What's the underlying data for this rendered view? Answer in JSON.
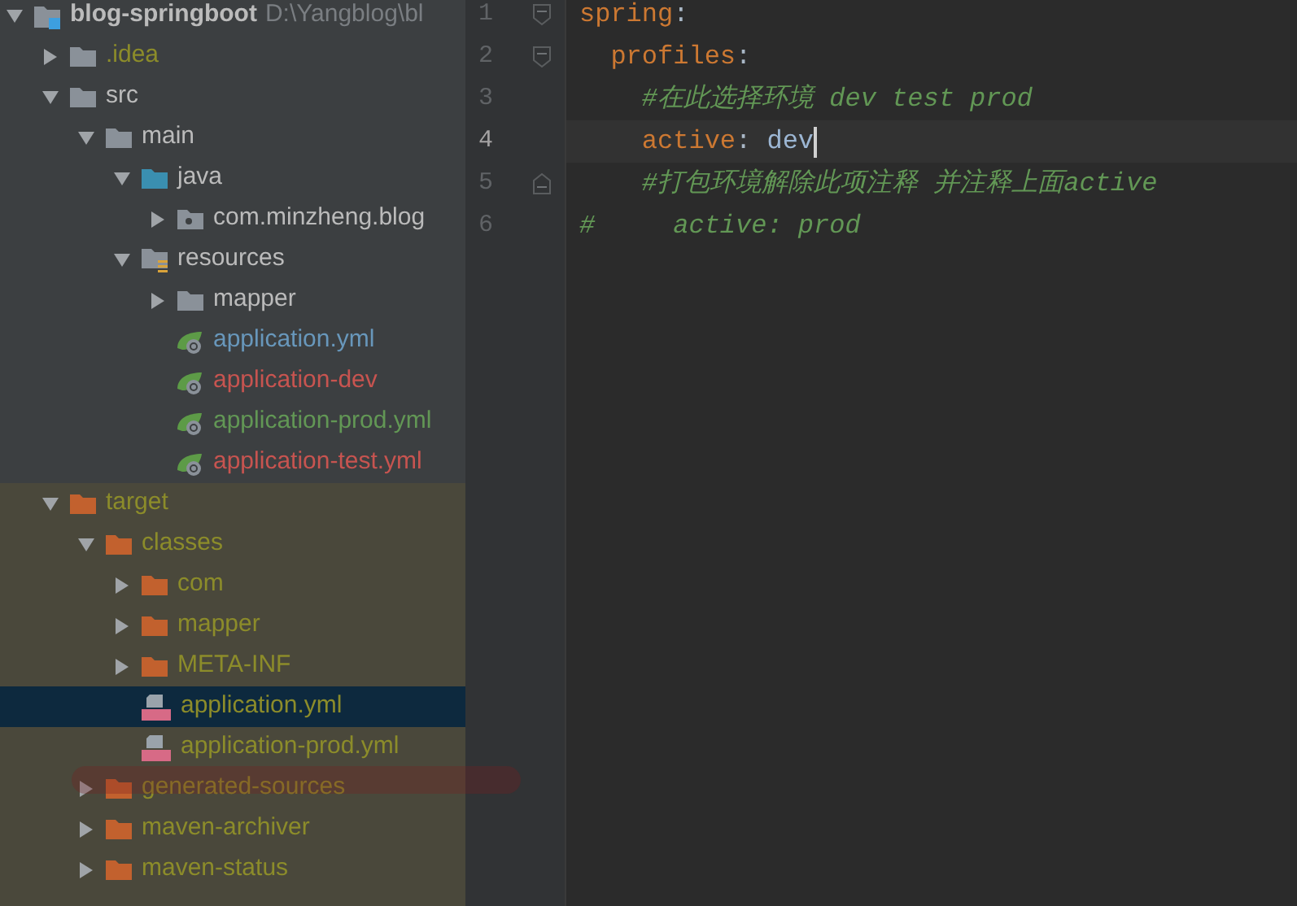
{
  "project_tree": [
    {
      "label": "blog-springboot",
      "path": "D:\\Yangblog\\bl",
      "kind": "module",
      "color": "#bbbbbb",
      "expanded": true,
      "selected": false,
      "excluded": false,
      "children": [
        {
          "label": ".idea",
          "kind": "folder",
          "color": "#8c8c2a",
          "expanded": false,
          "selected": false,
          "excluded": false
        },
        {
          "label": "src",
          "kind": "folder",
          "color": "#bbbbbb",
          "expanded": true,
          "selected": false,
          "excluded": false,
          "children": [
            {
              "label": "main",
              "kind": "folder",
              "color": "#bbbbbb",
              "expanded": true,
              "selected": false,
              "excluded": false,
              "children": [
                {
                  "label": "java",
                  "kind": "source",
                  "color": "#bbbbbb",
                  "expanded": true,
                  "selected": false,
                  "excluded": false,
                  "children": [
                    {
                      "label": "com.minzheng.blog",
                      "kind": "package",
                      "color": "#bbbbbb",
                      "expanded": false,
                      "selected": false,
                      "excluded": false
                    }
                  ]
                },
                {
                  "label": "resources",
                  "kind": "resources",
                  "color": "#bbbbbb",
                  "expanded": true,
                  "selected": false,
                  "excluded": false,
                  "children": [
                    {
                      "label": "mapper",
                      "kind": "folder",
                      "color": "#bbbbbb",
                      "expanded": false,
                      "selected": false,
                      "excluded": false
                    },
                    {
                      "label": "application.yml",
                      "kind": "spring",
                      "color": "#6897bb",
                      "selected": false,
                      "excluded": false
                    },
                    {
                      "label": "application-dev",
                      "kind": "spring",
                      "color": "#c75450",
                      "selected": false,
                      "excluded": false
                    },
                    {
                      "label": "application-prod.yml",
                      "kind": "spring",
                      "color": "#629755",
                      "selected": false,
                      "excluded": false
                    },
                    {
                      "label": "application-test.yml",
                      "kind": "spring",
                      "color": "#c75450",
                      "selected": false,
                      "excluded": false
                    }
                  ]
                }
              ]
            }
          ]
        },
        {
          "label": "target",
          "kind": "target",
          "color": "#8c8c2a",
          "expanded": true,
          "selected": false,
          "excluded": true,
          "children": [
            {
              "label": "classes",
              "kind": "target",
              "color": "#8c8c2a",
              "expanded": true,
              "selected": false,
              "excluded": true,
              "children": [
                {
                  "label": "com",
                  "kind": "target",
                  "color": "#8c8c2a",
                  "expanded": false,
                  "selected": false,
                  "excluded": true
                },
                {
                  "label": "mapper",
                  "kind": "target",
                  "color": "#8c8c2a",
                  "expanded": false,
                  "selected": false,
                  "excluded": true
                },
                {
                  "label": "META-INF",
                  "kind": "target",
                  "color": "#8c8c2a",
                  "expanded": false,
                  "selected": false,
                  "excluded": true
                },
                {
                  "label": "application.yml",
                  "kind": "yml",
                  "color": "#8c8c2a",
                  "selected": true,
                  "excluded": true
                },
                {
                  "label": "application-prod.yml",
                  "kind": "yml",
                  "color": "#8c8c2a",
                  "selected": false,
                  "excluded": true
                }
              ]
            },
            {
              "label": "generated-sources",
              "kind": "target",
              "color": "#8c8c2a",
              "expanded": false,
              "selected": false,
              "excluded": true
            },
            {
              "label": "maven-archiver",
              "kind": "target",
              "color": "#8c8c2a",
              "expanded": false,
              "selected": false,
              "excluded": true
            },
            {
              "label": "maven-status",
              "kind": "target",
              "color": "#8c8c2a",
              "expanded": false,
              "selected": false,
              "excluded": true
            }
          ]
        }
      ]
    }
  ],
  "editor": {
    "lines": [
      {
        "number": "1",
        "fold_start": true,
        "fold_end": false,
        "current": false,
        "caret": false,
        "tokens": [
          {
            "kind": "key",
            "text": "spring"
          },
          {
            "kind": "punct",
            "text": ":"
          }
        ]
      },
      {
        "number": "2",
        "fold_start": true,
        "fold_end": false,
        "current": false,
        "caret": false,
        "tokens": [
          {
            "kind": "key",
            "text": "  profiles"
          },
          {
            "kind": "punct",
            "text": ":"
          }
        ]
      },
      {
        "number": "3",
        "fold_start": false,
        "fold_end": false,
        "current": false,
        "caret": false,
        "tokens": [
          {
            "kind": "comment",
            "text": "    #在此选择环境 dev test prod"
          }
        ]
      },
      {
        "number": "4",
        "fold_start": false,
        "fold_end": false,
        "current": true,
        "caret": true,
        "tokens": [
          {
            "kind": "key",
            "text": "    active"
          },
          {
            "kind": "punct",
            "text": ": "
          },
          {
            "kind": "value",
            "text": "dev"
          }
        ]
      },
      {
        "number": "5",
        "fold_start": false,
        "fold_end": true,
        "current": false,
        "caret": false,
        "tokens": [
          {
            "kind": "comment",
            "text": "    #打包环境解除此项注释 并注释上面active"
          }
        ]
      },
      {
        "number": "6",
        "fold_start": false,
        "fold_end": false,
        "current": false,
        "caret": false,
        "tokens": [
          {
            "kind": "comment",
            "text": "#     active: prod"
          }
        ]
      }
    ]
  }
}
